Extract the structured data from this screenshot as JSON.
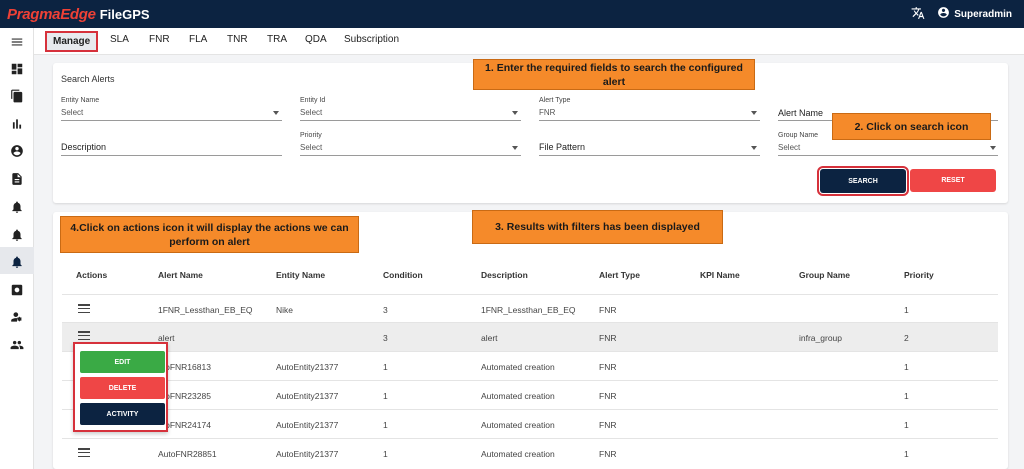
{
  "header": {
    "brand": "PragmaEdge",
    "product": "FileGPS",
    "user": "Superadmin"
  },
  "tabs": [
    "Manage",
    "SLA",
    "FNR",
    "FLA",
    "TNR",
    "TRA",
    "QDA",
    "Subscription"
  ],
  "search": {
    "title": "Search Alerts",
    "fields": {
      "entity_name": {
        "label": "Entity Name",
        "value": "Select"
      },
      "entity_id": {
        "label": "Entity Id",
        "value": "Select"
      },
      "alert_type": {
        "label": "Alert Type",
        "value": "FNR"
      },
      "alert_name": {
        "label": "Alert Name"
      },
      "description": {
        "label": "Description"
      },
      "priority": {
        "label": "Priority",
        "value": "Select"
      },
      "file_pattern": {
        "label": "File Pattern"
      },
      "group_name": {
        "label": "Group Name",
        "value": "Select"
      }
    },
    "search_button": "SEARCH",
    "reset_button": "RESET"
  },
  "callouts": {
    "c1": "1. Enter the required fields to search the configured alert",
    "c2": "2. Click on search icon",
    "c3": "3. Results with filters has been displayed",
    "c4": "4.Click on actions icon it will display the actions we can perform on alert"
  },
  "table": {
    "columns": [
      "Actions",
      "Alert Name",
      "Entity Name",
      "Condition",
      "Description",
      "Alert Type",
      "KPI Name",
      "Group Name",
      "Priority"
    ],
    "rows": [
      {
        "alert_name": "1FNR_Lessthan_EB_EQ",
        "entity_name": "Nike",
        "condition": "3",
        "description": "1FNR_Lessthan_EB_EQ",
        "alert_type": "FNR",
        "kpi_name": "",
        "group_name": "",
        "priority": "1"
      },
      {
        "alert_name": "alert",
        "entity_name": "",
        "condition": "3",
        "description": "alert",
        "alert_type": "FNR",
        "kpi_name": "",
        "group_name": "infra_group",
        "priority": "2"
      },
      {
        "alert_name": "utoFNR16813",
        "entity_name": "AutoEntity21377",
        "condition": "1",
        "description": "Automated creation",
        "alert_type": "FNR",
        "kpi_name": "",
        "group_name": "",
        "priority": "1"
      },
      {
        "alert_name": "utoFNR23285",
        "entity_name": "AutoEntity21377",
        "condition": "1",
        "description": "Automated creation",
        "alert_type": "FNR",
        "kpi_name": "",
        "group_name": "",
        "priority": "1"
      },
      {
        "alert_name": "utoFNR24174",
        "entity_name": "AutoEntity21377",
        "condition": "1",
        "description": "Automated creation",
        "alert_type": "FNR",
        "kpi_name": "",
        "group_name": "",
        "priority": "1"
      },
      {
        "alert_name": "AutoFNR28851",
        "entity_name": "AutoEntity21377",
        "condition": "1",
        "description": "Automated creation",
        "alert_type": "FNR",
        "kpi_name": "",
        "group_name": "",
        "priority": "1"
      }
    ]
  },
  "actions_menu": {
    "edit": "EDIT",
    "delete": "DELETE",
    "activity": "ACTIVITY"
  },
  "icons": {
    "nav": [
      "menu-icon",
      "dashboard-icon",
      "copy-icon",
      "bar-chart-icon",
      "account-circle-icon",
      "file-icon",
      "bell-ring-icon",
      "bell-icon",
      "settings-icon",
      "user-settings-icon",
      "group-icon"
    ]
  },
  "colors": {
    "navy": "#0c2341",
    "accent_red": "#d6313b",
    "reset_red": "#ef4646",
    "callout_orange": "#f58a2a",
    "edit_green": "#3aaa45",
    "delete_red": "#ef4646"
  }
}
